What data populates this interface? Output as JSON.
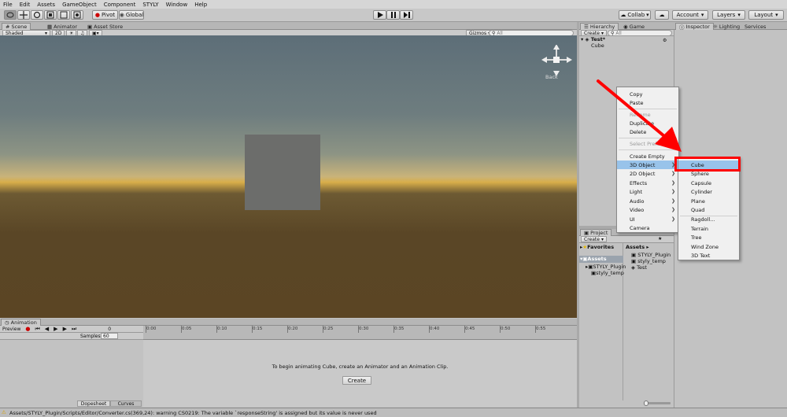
{
  "menu": [
    "File",
    "Edit",
    "Assets",
    "GameObject",
    "Component",
    "STYLY",
    "Window",
    "Help"
  ],
  "toolbar": {
    "pivot": "Pivot",
    "global": "Global",
    "collab": "Collab",
    "account": "Account",
    "layers": "Layers",
    "layout": "Layout"
  },
  "scene_tabs": {
    "scene": "Scene",
    "animator": "Animator",
    "asset_store": "Asset Store"
  },
  "scene_bar": {
    "shading": "Shaded",
    "mode_2d": "2D",
    "gizmos": "Gizmos",
    "search_placeholder": "All"
  },
  "gizmo": {
    "back_label": "Back"
  },
  "hierarchy": {
    "tab": "Hierarchy",
    "game_tab": "Game",
    "create": "Create",
    "search_placeholder": "All",
    "scene_name": "Test*",
    "items": [
      "Cube"
    ]
  },
  "inspector": {
    "tab": "Inspector",
    "lighting": "Lighting",
    "services": "Services"
  },
  "context_menu": {
    "items": [
      "Copy",
      "Paste",
      "Rename",
      "Duplicate",
      "Delete",
      "Select Prefab",
      "Create Empty",
      "3D Object",
      "2D Object",
      "Effects",
      "Light",
      "Audio",
      "Video",
      "UI",
      "Camera"
    ]
  },
  "submenu": {
    "items": [
      "Cube",
      "Sphere",
      "Capsule",
      "Cylinder",
      "Plane",
      "Quad",
      "Ragdoll...",
      "Terrain",
      "Tree",
      "Wind Zone",
      "3D Text"
    ]
  },
  "project": {
    "tab": "Project",
    "create": "Create",
    "favorites": "Favorites",
    "assets": "Assets",
    "tree_children": [
      "STYLY_Plugin",
      "styly_temp"
    ],
    "header": "Assets",
    "files": [
      "STYLY_Plugin",
      "styly_temp",
      "Test"
    ]
  },
  "animation": {
    "tab": "Animation",
    "preview": "Preview",
    "samples_label": "Samples",
    "samples_value": "60",
    "frame_value": "0",
    "ticks": [
      "0:00",
      "0:05",
      "0:10",
      "0:15",
      "0:20",
      "0:25",
      "0:30",
      "0:35",
      "0:40",
      "0:45",
      "0:50",
      "0:55"
    ],
    "message": "To begin animating Cube, create an Animator and an Animation Clip.",
    "create": "Create",
    "dopesheet": "Dopesheet",
    "curves": "Curves"
  },
  "status": {
    "message": "Assets/STYLY_Plugin/Scripts/Editor/Converter.cs(369,24): warning CS0219: The variable `responseString' is assigned but its value is never used"
  },
  "colors": {
    "highlight": "#98c3ea",
    "callout_red": "#ff0000",
    "cube": "#6c6d6b"
  }
}
